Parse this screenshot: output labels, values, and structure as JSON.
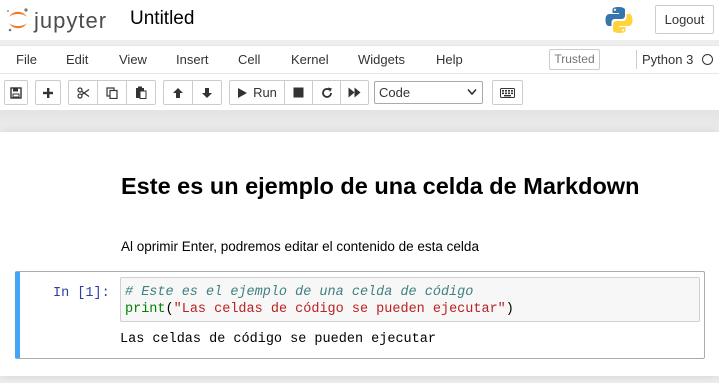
{
  "header": {
    "logo_text": "jupyter",
    "notebook_title": "Untitled",
    "logout_label": "Logout"
  },
  "menubar": {
    "items": [
      "File",
      "Edit",
      "View",
      "Insert",
      "Cell",
      "Kernel",
      "Widgets",
      "Help"
    ],
    "trusted_label": "Trusted",
    "kernel_name": "Python 3"
  },
  "toolbar": {
    "run_label": "Run",
    "cell_type": "Code",
    "icons": [
      "save-icon",
      "plus-icon",
      "scissors-icon",
      "copy-icon",
      "paste-icon",
      "arrow-up-icon",
      "arrow-down-icon",
      "play-icon",
      "stop-icon",
      "restart-icon",
      "fast-forward-icon",
      "keyboard-icon"
    ]
  },
  "notebook": {
    "markdown_cell": {
      "heading": "Este es un ejemplo de una celda de Markdown",
      "paragraph": "Al oprimir Enter, podremos editar el contenido de esta celda"
    },
    "code_cell": {
      "prompt": "In [1]:",
      "comment_line": "# Este es el ejemplo de una celda de código",
      "print_fn": "print",
      "open_paren": "(",
      "string_literal": "\"Las celdas de código se pueden ejecutar\"",
      "close_paren": ")",
      "output": "Las celdas de código se pueden ejecutar"
    }
  },
  "colors": {
    "cell_selected_border": "#42a5f5",
    "prompt": "#303f9f",
    "comment": "#408080",
    "builtin": "#008000",
    "string": "#ba2121",
    "jupyter_orange": "#f37726"
  }
}
